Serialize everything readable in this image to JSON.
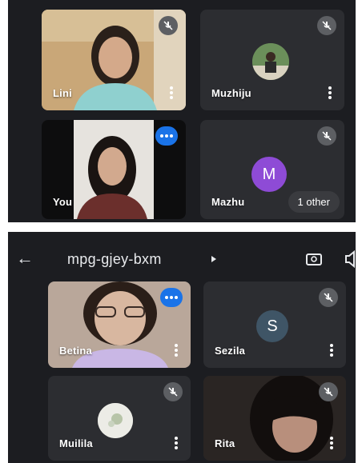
{
  "screen1": {
    "tiles": [
      {
        "name": "Lini"
      },
      {
        "name": "Muzhiju"
      },
      {
        "name": "You"
      },
      {
        "name": "Mazhu",
        "avatar_letter": "M"
      }
    ],
    "others_pill": "1 other"
  },
  "screen2": {
    "meeting_code": "mpg-gjey-bxm",
    "tiles": [
      {
        "name": "Betina"
      },
      {
        "name": "Sezila",
        "avatar_letter": "S"
      },
      {
        "name": "Muilila"
      },
      {
        "name": "Rita"
      }
    ]
  },
  "colors": {
    "accent_blue": "#1a73e8",
    "avatar_purple": "#8e4bd6",
    "avatar_slate": "#3f5566",
    "panel_bg": "#1c1d21"
  },
  "icons": [
    "back-arrow-icon",
    "camera-switch-icon",
    "speaker-icon",
    "mic-off-icon",
    "more-vert-icon",
    "speaking-indicator-icon"
  ]
}
